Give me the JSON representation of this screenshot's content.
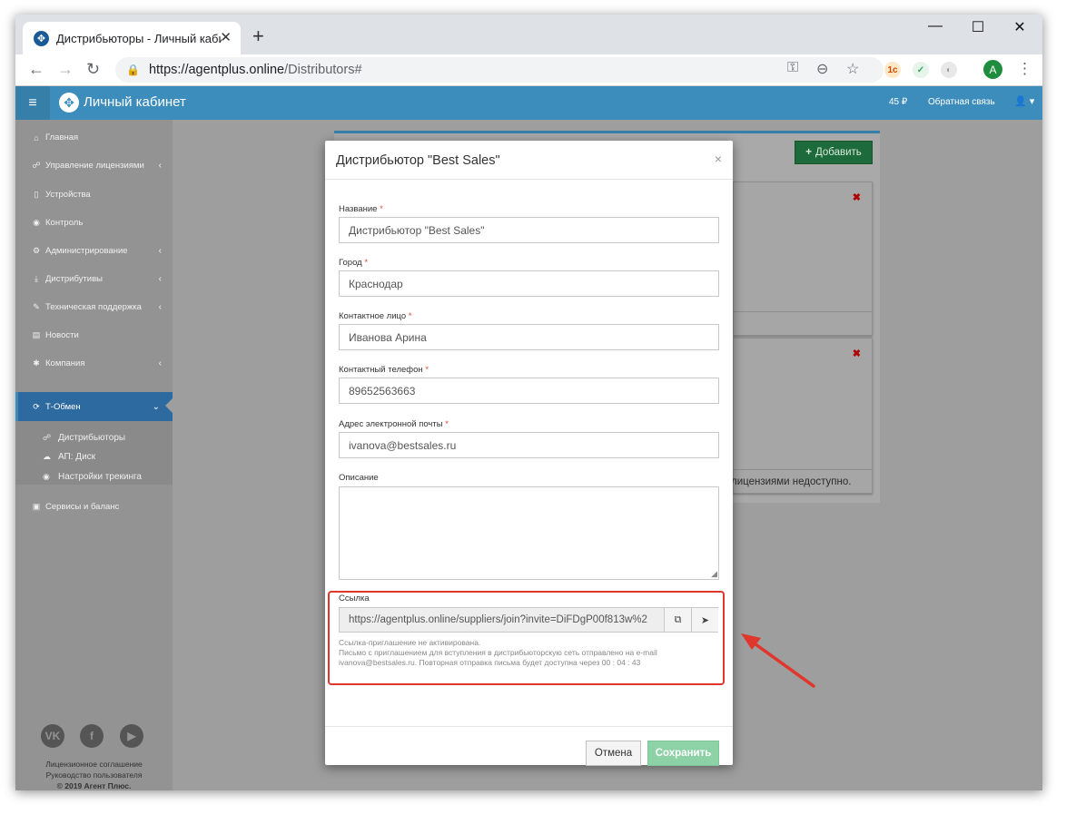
{
  "browser": {
    "tab_title": "Дистрибьюторы - Личный кабинет",
    "tab_close": "✕",
    "new_tab": "+",
    "controls": {
      "minimize": "—",
      "maximize": "☐",
      "close": "✕"
    },
    "url_host": "https://agentplus.online",
    "url_path": "/Distributors#",
    "profile_initial": "A"
  },
  "header": {
    "title": "Личный кабинет",
    "balance": "45 ₽",
    "feedback": "Обратная связь",
    "user_menu": "👤 ▾"
  },
  "sidebar": {
    "items": [
      {
        "label": "Главная",
        "icon": "home-icon",
        "glyph": "⌂"
      },
      {
        "label": "Управление лицензиями",
        "icon": "sitemap-icon",
        "glyph": "☍",
        "chevron": "‹"
      },
      {
        "label": "Устройства",
        "icon": "mobile-icon",
        "glyph": "▯"
      },
      {
        "label": "Контроль",
        "icon": "dashboard-icon",
        "glyph": "◉"
      },
      {
        "label": "Администрирование",
        "icon": "cogs-icon",
        "glyph": "⚙",
        "chevron": "‹"
      },
      {
        "label": "Дистрибутивы",
        "icon": "download-icon",
        "glyph": "⤓",
        "chevron": "‹"
      },
      {
        "label": "Техническая поддержка",
        "icon": "wrench-icon",
        "glyph": "✎",
        "chevron": "‹"
      },
      {
        "label": "Новости",
        "icon": "newspaper-icon",
        "glyph": "▤"
      },
      {
        "label": "Компания",
        "icon": "gear-icon",
        "glyph": "✱",
        "chevron": "‹"
      },
      {
        "label": "Т-Обмен",
        "icon": "refresh-icon",
        "glyph": "⟳",
        "chevron": "⌄"
      }
    ],
    "subitems": [
      {
        "label": "Дистрибьюторы",
        "icon": "sitemap-icon",
        "glyph": "☍"
      },
      {
        "label": "АП: Диск",
        "icon": "cloud-icon",
        "glyph": "☁"
      },
      {
        "label": "Настройки трекинга",
        "icon": "globe-icon",
        "glyph": "◉"
      }
    ],
    "services": {
      "label": "Сервисы и баланс",
      "icon": "money-icon",
      "glyph": "▣"
    },
    "social": [
      "VK",
      "f",
      "▶"
    ],
    "footer": {
      "license": "Лицензионное соглашение",
      "guide": "Руководство пользователя",
      "copyright": "© 2019 Агент Плюс."
    }
  },
  "content": {
    "add_button": "Добавить",
    "card_delete": "✖",
    "card_footer_fragment": "лицензиями недоступно."
  },
  "modal": {
    "title": "Дистрибьютор \"Best Sales\"",
    "close": "×",
    "fields": {
      "name": {
        "label": "Название",
        "value": "Дистрибьютор \"Best Sales\""
      },
      "city": {
        "label": "Город",
        "value": "Краснодар"
      },
      "contact": {
        "label": "Контактное лицо",
        "value": "Иванова Арина"
      },
      "phone": {
        "label": "Контактный телефон",
        "value": "89652563663"
      },
      "email": {
        "label": "Адрес электронной почты",
        "value": "ivanova@bestsales.ru"
      },
      "description": {
        "label": "Описание",
        "value": ""
      },
      "link": {
        "label": "Ссылка",
        "value": "https://agentplus.online/suppliers/join?invite=DiFDgP00f813w%2"
      }
    },
    "required_mark": "*",
    "help": {
      "line1": "Ссылка-приглашение не активирована.",
      "line2": "Письмо с приглашением для вступления в дистрибьюторскую сеть отправлено на e-mail",
      "line3": "ivanova@bestsales.ru. Повторная отправка письма будет доступна через 00 : 04 : 43"
    },
    "cancel": "Отмена",
    "save": "Сохранить"
  },
  "colors": {
    "header_blue": "#3c8dbc",
    "highlight_red": "#e0362c",
    "save_green": "#8cd2a6",
    "add_green": "#1d6a3a"
  }
}
